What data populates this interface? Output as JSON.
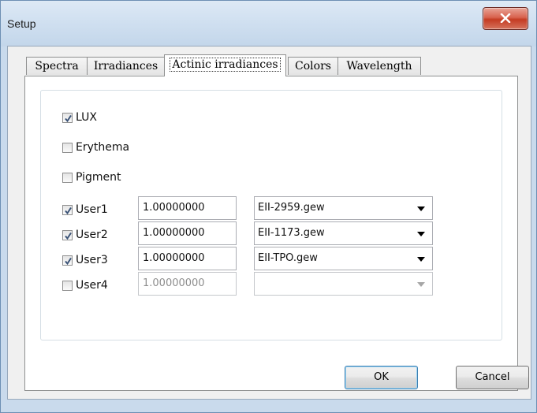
{
  "window": {
    "title": "Setup"
  },
  "tabs": [
    {
      "label": "Spectra"
    },
    {
      "label": "Irradiances"
    },
    {
      "label": "Actinic irradiances"
    },
    {
      "label": "Colors"
    },
    {
      "label": "Wavelength"
    }
  ],
  "active_tab": "Actinic irradiances",
  "options": {
    "lux": {
      "label": "LUX",
      "checked": true
    },
    "erythema": {
      "label": "Erythema",
      "checked": false
    },
    "pigment": {
      "label": "Pigment",
      "checked": false
    }
  },
  "users": [
    {
      "label": "User1",
      "checked": true,
      "factor": "1.00000000",
      "file": "EII-2959.gew",
      "enabled": true
    },
    {
      "label": "User2",
      "checked": true,
      "factor": "1.00000000",
      "file": "EII-1173.gew",
      "enabled": true
    },
    {
      "label": "User3",
      "checked": true,
      "factor": "1.00000000",
      "file": "EII-TPO.gew",
      "enabled": true
    },
    {
      "label": "User4",
      "checked": false,
      "factor": "1.00000000",
      "file": "",
      "enabled": false
    }
  ],
  "buttons": {
    "ok": "OK",
    "cancel": "Cancel"
  },
  "colors": {
    "check": "#3a5276",
    "titlebar": "#cfdff0",
    "close": "#c43b22"
  }
}
